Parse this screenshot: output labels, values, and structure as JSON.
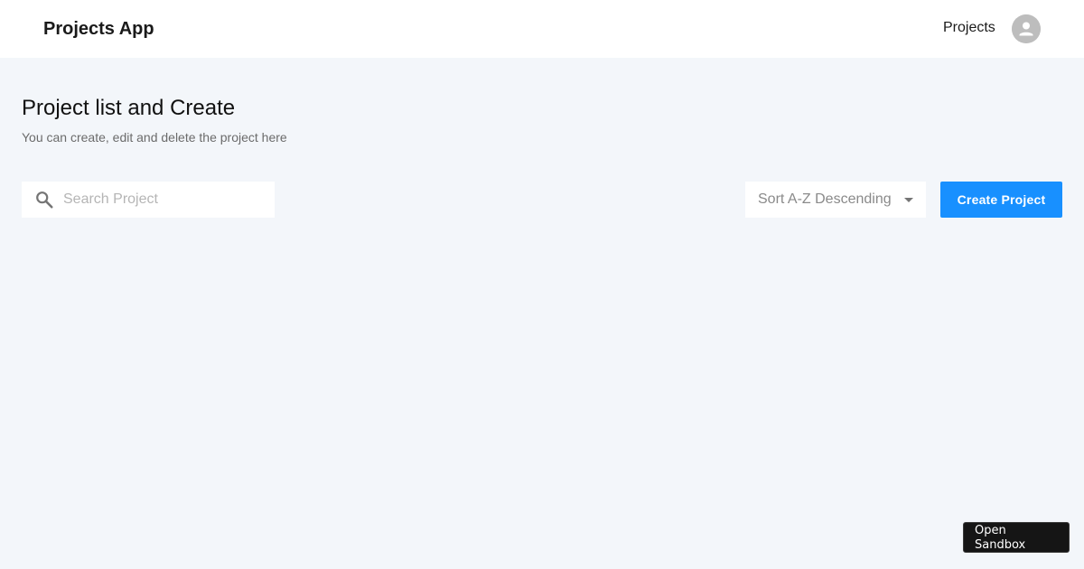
{
  "header": {
    "app_title": "Projects App",
    "nav_link": "Projects",
    "avatar_icon": "account-circle-icon"
  },
  "main": {
    "title": "Project list and Create",
    "subtitle": "You can create, edit and delete the project here"
  },
  "toolbar": {
    "search": {
      "placeholder": "Search Project",
      "value": "",
      "icon": "search-icon"
    },
    "sort": {
      "selected": "Sort A-Z Descending",
      "icon": "caret-down-icon"
    },
    "create_label": "Create Project"
  },
  "footer": {
    "sandbox_label": "Open Sandbox"
  },
  "colors": {
    "primary": "#1890ff",
    "background": "#f3f6fa",
    "header": "#ffffff"
  }
}
